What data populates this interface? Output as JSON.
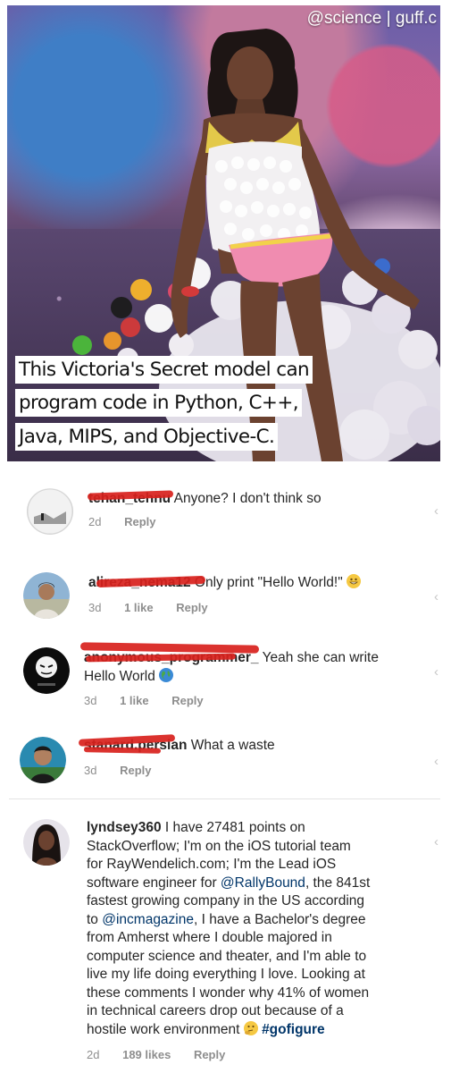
{
  "post": {
    "watermark": "@science | guff.c",
    "caption_lines": [
      "This Victoria's Secret model can",
      "program code in Python, C++,",
      "Java, MIPS, and Objective-C."
    ]
  },
  "comments": [
    {
      "username": "tehan_tehnu",
      "text": "Anyone? I don't think so",
      "time": "2d",
      "likes": "",
      "reply": "Reply"
    },
    {
      "username": "alireza_nema12",
      "text": "Only print \"Hello World!\"",
      "emoji": "grinning-emoji",
      "time": "3d",
      "likes": "1 like",
      "reply": "Reply"
    },
    {
      "username": "anonymous_programmer_",
      "text": "Yeah she can write",
      "text2": "Hello World",
      "emoji": "globe-emoji",
      "time": "3d",
      "likes": "1 like",
      "reply": "Reply"
    },
    {
      "username": "stanard.persian",
      "text": "What a waste",
      "time": "3d",
      "likes": "",
      "reply": "Reply"
    },
    {
      "username": "lyndsey360",
      "lines": [
        "I have 27481 points on",
        "StackOverflow; I'm on the iOS tutorial team",
        "for RayWendelich.com; I'm the Lead iOS",
        "software engineer for ",
        ", the 841st",
        "fastest growing company in the US according",
        "to ",
        ", I have a Bachelor's degree",
        "from Amherst where I double majored in",
        "computer science and theater, and I'm able to",
        "live my life doing everything I love. Looking at",
        "these comments I wonder why 41% of women",
        "in technical careers drop out because of a",
        "hostile work environment "
      ],
      "mention1": "@RallyBound",
      "mention2": "@incmagazine",
      "hashtag": "#gofigure",
      "emoji": "thinking-emoji",
      "time": "2d",
      "likes": "189 likes",
      "reply": "Reply"
    }
  ],
  "colors": {
    "text": "#262626",
    "meta": "#8e8e8e",
    "link": "#003569",
    "scribble": "#d8211c"
  }
}
